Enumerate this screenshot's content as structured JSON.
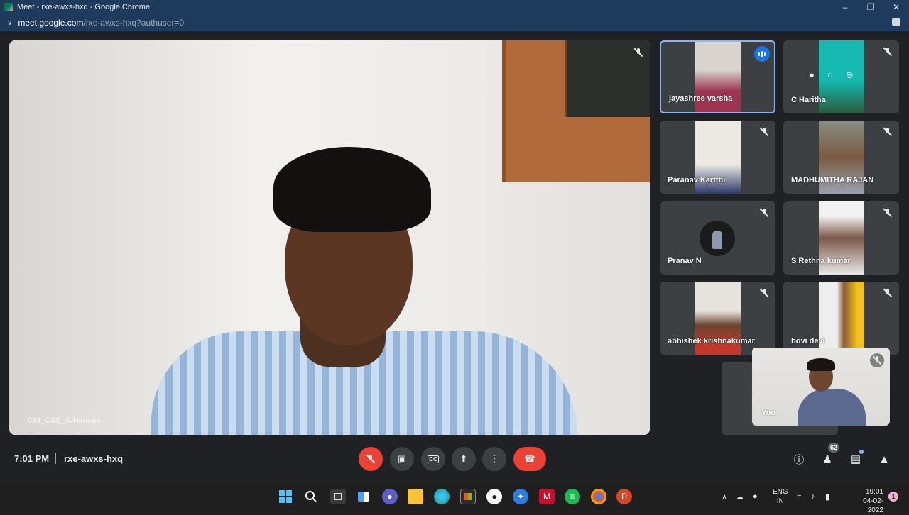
{
  "browser": {
    "window_title": "Meet - rxe-awxs-hxq - Google Chrome",
    "url_host": "meet.google.com",
    "url_path": "/rxe-awxs-hxq?authuser=0"
  },
  "main_speaker": {
    "name": "034_CSE_S.Hariram"
  },
  "participants": [
    {
      "name": "jayashree varsha",
      "speaking": true
    },
    {
      "name": "C Haritha",
      "speaking": false
    },
    {
      "name": "Paranav Kartthi",
      "speaking": false
    },
    {
      "name": "MADHUMITHA RAJAN",
      "speaking": false
    },
    {
      "name": "Pranav N",
      "speaking": false
    },
    {
      "name": "S Rethna kumar",
      "speaking": false
    },
    {
      "name": "abhishek krishnakumar",
      "speaking": false
    },
    {
      "name": "bovi devi",
      "speaking": false
    }
  ],
  "self_view": {
    "name": "You"
  },
  "controls": {
    "time": "7:01 PM",
    "meeting_code": "rxe-awxs-hxq",
    "participant_count": "62"
  },
  "taskbar": {
    "language_line1": "ENG",
    "language_line2": "IN",
    "clock_time": "19:01",
    "clock_date": "04-02-2022",
    "notification_count": "1"
  },
  "colors": {
    "meet_bg": "#202124",
    "tile_bg": "#3c4043",
    "mute_red": "#ea4335",
    "active_blue": "#8ab4f8",
    "chrome_frame": "#1e3a5c"
  }
}
